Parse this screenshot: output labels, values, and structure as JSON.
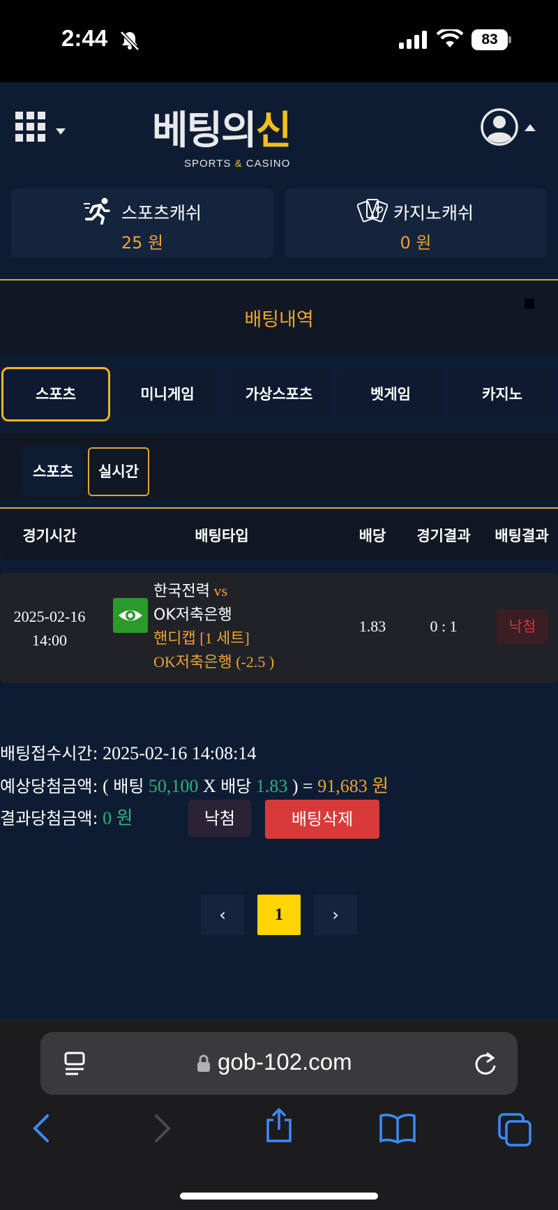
{
  "status": {
    "time": "2:44",
    "battery": "83"
  },
  "header": {
    "logo_main": "베팅의",
    "logo_accent": "신",
    "logo_sub_left": "SPORTS",
    "logo_sub_amp": "&",
    "logo_sub_right": "CASINO"
  },
  "cash": {
    "sports_label": "스포츠캐쉬",
    "sports_value": "25 원",
    "casino_label": "카지노캐쉬",
    "casino_value": "0 원"
  },
  "page_title": "배팅내역",
  "tabs": [
    "스포츠",
    "미니게임",
    "가상스포츠",
    "벳게임",
    "카지노"
  ],
  "subtabs": [
    "스포츠",
    "실시간"
  ],
  "table": {
    "headers": [
      "경기시간",
      "배팅타입",
      "배당",
      "경기결과",
      "배팅결과"
    ],
    "row": {
      "date": "2025-02-16",
      "time": "14:00",
      "home": "한국전력",
      "vs": "vs",
      "away": "OK저축은행",
      "market": "핸디캡 [1 세트]",
      "pick": "OK저축은행 (-2.5 )",
      "odds": "1.83",
      "score": "0 : 1",
      "result": "낙첨"
    }
  },
  "bet_info": {
    "time_label": "배팅접수시간:",
    "time_value": "2025-02-16 14:08:14",
    "expected_label": "예상당첨금액:",
    "open_paren": "(",
    "bet_word": "배팅",
    "bet_amount": "50,100",
    "x_sign": "X",
    "odds_word": "배당",
    "odds_value": "1.83",
    "close_eq": ") =",
    "expected_value": "91,683 원",
    "result_label": "결과당첨금액:",
    "result_value": "0 원",
    "lose_button": "낙첨",
    "delete_button": "배팅삭제"
  },
  "pagination": {
    "prev": "‹",
    "current": "1",
    "next": "›"
  },
  "browser": {
    "url": "gob-102.com"
  },
  "colors": {
    "accent": "#f0a430",
    "gold_border": "#f2b521",
    "green": "#2db37a",
    "danger": "#d83a3a"
  }
}
